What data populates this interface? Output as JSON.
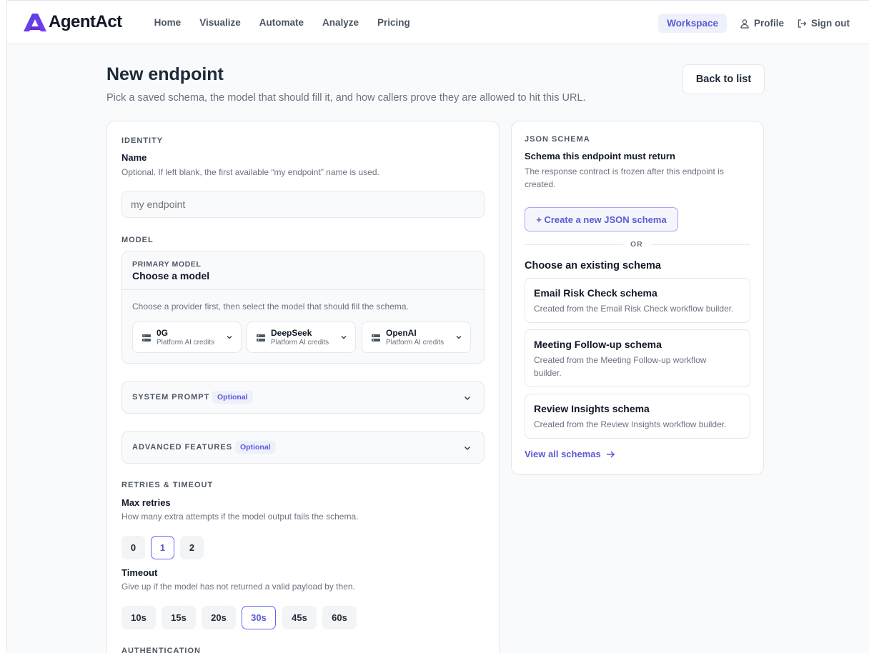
{
  "header": {
    "brand": "AgentAct",
    "nav": [
      "Home",
      "Visualize",
      "Automate",
      "Analyze",
      "Pricing"
    ],
    "workspace": "Workspace",
    "profile": "Profile",
    "signout": "Sign out"
  },
  "page": {
    "title": "New endpoint",
    "subtitle": "Pick a saved schema, the model that should fill it, and how callers prove they are allowed to hit this URL.",
    "back": "Back to list"
  },
  "identity": {
    "section": "IDENTITY",
    "name_label": "Name",
    "name_help": "Optional. If left blank, the first available “my endpoint” name is used.",
    "name_placeholder": "my endpoint"
  },
  "model": {
    "section": "MODEL",
    "primary_label": "PRIMARY MODEL",
    "primary_value": "Choose a model",
    "help": "Choose a provider first, then select the model that should fill the schema.",
    "providers": [
      {
        "name": "0G",
        "sub": "Platform AI credits"
      },
      {
        "name": "DeepSeek",
        "sub": "Platform AI credits"
      },
      {
        "name": "OpenAI",
        "sub": "Platform AI credits"
      }
    ]
  },
  "system_prompt": {
    "label": "SYSTEM PROMPT",
    "badge": "Optional"
  },
  "advanced": {
    "label": "ADVANCED FEATURES",
    "badge": "Optional"
  },
  "retries": {
    "section": "RETRIES & TIMEOUT",
    "max_label": "Max retries",
    "max_help": "How many extra attempts if the model output fails the schema.",
    "options": [
      "0",
      "1",
      "2"
    ],
    "selected": "1",
    "timeout_label": "Timeout",
    "timeout_help": "Give up if the model has not returned a valid payload by then.",
    "timeouts": [
      "10s",
      "15s",
      "20s",
      "30s",
      "45s",
      "60s"
    ],
    "timeout_selected": "30s"
  },
  "auth": {
    "section": "AUTHENTICATION"
  },
  "schema": {
    "section": "JSON SCHEMA",
    "title": "Schema this endpoint must return",
    "help": "The response contract is frozen after this endpoint is created.",
    "create": "+ Create a new JSON schema",
    "or": "OR",
    "choose": "Choose an existing schema",
    "items": [
      {
        "title": "Email Risk Check schema",
        "desc": "Created from the Email Risk Check workflow builder."
      },
      {
        "title": "Meeting Follow-up schema",
        "desc": "Created from the Meeting Follow-up workflow builder."
      },
      {
        "title": "Review Insights schema",
        "desc": "Created from the Review Insights workflow builder."
      }
    ],
    "view_all": "View all schemas"
  },
  "colors": {
    "accent": "#5b5bd6",
    "brand_gradient_start": "#4f46e5",
    "brand_gradient_end": "#7c3aed"
  }
}
